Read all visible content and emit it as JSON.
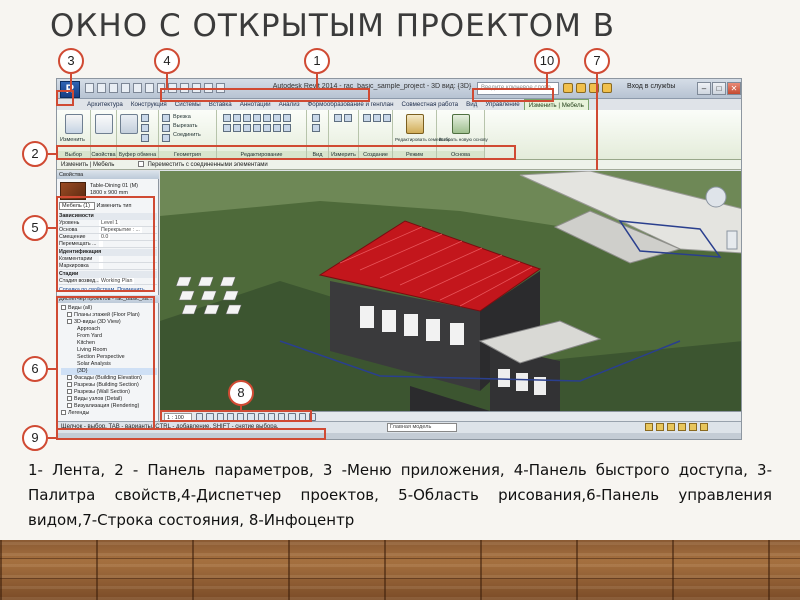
{
  "slide": {
    "title": "ОКНО С ОТКРЫТЫМ ПРОЕКТОМ В",
    "caption": "1- Лента, 2 - Панель параметров, 3 -Меню приложения, 4-Панель быстрого доступа, 3-Палитра свойств,4-Диспетчер проектов, 5-Область рисования,6-Панель управления видом,7-Строка состояния, 8-Инфоцентр"
  },
  "callouts": [
    "1",
    "2",
    "3",
    "4",
    "5",
    "6",
    "7",
    "8",
    "9",
    "10"
  ],
  "app": {
    "app_button": "R",
    "window_title": "Autodesk Revit 2014 - rac_basic_sample_project - 3D вид: {3D}",
    "search_placeholder": "Введите ключевое слово",
    "signin": "Вход в службы",
    "window_buttons": [
      "–",
      "□",
      "✕"
    ]
  },
  "ribbon": {
    "tabs": [
      "Архитектура",
      "Конструкция",
      "Системы",
      "Вставка",
      "Аннотации",
      "Анализ",
      "Формообразование и генплан",
      "Совместная работа",
      "Вид",
      "Управление",
      "Изменить | Мебель"
    ],
    "panels": [
      {
        "label": "Выбор",
        "button": "Изменить"
      },
      {
        "label": "Свойства"
      },
      {
        "label": "Буфер обмена"
      },
      {
        "label": "Геометрия",
        "items": [
          "Врезка",
          "Вырезать",
          "Соединить"
        ]
      },
      {
        "label": "Редактирование"
      },
      {
        "label": "Вид"
      },
      {
        "label": "Измерить"
      },
      {
        "label": "Создание"
      },
      {
        "label": "Режим",
        "button": "Редактировать семейство"
      },
      {
        "label": "Основа",
        "button": "Выбрать новую основу"
      }
    ]
  },
  "options_bar": {
    "context": "Изменить | Мебель",
    "checkbox": "Переместить с соединенными элементами"
  },
  "properties": {
    "header": "Свойства",
    "family": "Table-Dining 01 (M)",
    "size": "1800 x 900 mm",
    "type_selector": "Мебель (1)",
    "edit_type": "Изменить тип",
    "groups": [
      {
        "name": "Зависимости",
        "rows": [
          {
            "k": "Уровень",
            "v": "Level 1"
          },
          {
            "k": "Основа",
            "v": "Перекрытие : ..."
          },
          {
            "k": "Смещение",
            "v": "0.0"
          },
          {
            "k": "Перемещать ...",
            "v": ""
          }
        ]
      },
      {
        "name": "Идентификация",
        "rows": [
          {
            "k": "Комментарии",
            "v": ""
          },
          {
            "k": "Маркировка",
            "v": ""
          }
        ]
      },
      {
        "name": "Стадии",
        "rows": [
          {
            "k": "Стадия возвед...",
            "v": "Working Plan"
          }
        ]
      }
    ],
    "help_link": "Справка по свойствам",
    "apply": "Применить"
  },
  "project_browser": {
    "header": "Диспетчер проектов - rac_basic_sa...",
    "items": [
      "Виды (all)",
      "Планы этажей (Floor Plan)",
      "3D-виды (3D View)",
      "Approach",
      "From Yard",
      "Kitchen",
      "Living Room",
      "Section Perspective",
      "Solar Analysis",
      "{3D}",
      "Фасады (Building Elevation)",
      "Разрезы (Building Section)",
      "Разрезы (Wall Section)",
      "Виды узлов (Detail)",
      "Визуализация (Rendering)",
      "Легенды"
    ],
    "selected_index": 9
  },
  "view_control": {
    "scale": "1 : 100"
  },
  "status_bar": {
    "text": "Щелчок - выбор, TAB - варианты, CTRL - добавление, SHIFT - снятие выбора.",
    "model": "Главная модель"
  },
  "colors": {
    "callout": "#d04a33",
    "terrain": "#4d6838",
    "roof": "#c3161c",
    "ribbon": "#e4ecda"
  }
}
